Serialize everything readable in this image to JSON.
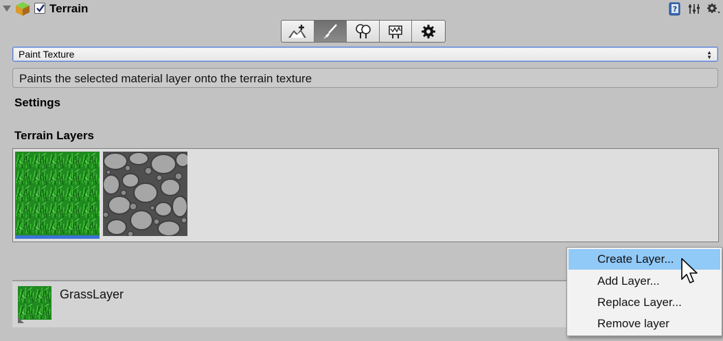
{
  "header": {
    "component_title": "Terrain",
    "enabled": true,
    "icons": [
      "foldout-arrow-icon",
      "terrain-cube-icon",
      "help-book-icon",
      "preset-sliders-icon",
      "settings-gear-icon"
    ]
  },
  "toolbar": {
    "tools": [
      {
        "icon": "raise-terrain-icon",
        "active": false
      },
      {
        "icon": "paint-brush-icon",
        "active": true
      },
      {
        "icon": "place-trees-icon",
        "active": false
      },
      {
        "icon": "paint-details-icon",
        "active": false
      },
      {
        "icon": "terrain-settings-gear-icon",
        "active": false
      }
    ]
  },
  "tool_mode": {
    "selected": "Paint Texture"
  },
  "description": "Paints the selected material layer onto the terrain texture",
  "sections": {
    "settings": "Settings",
    "terrain_layers": "Terrain Layers"
  },
  "terrain_layers": [
    {
      "texture": "grass",
      "selected": true
    },
    {
      "texture": "stone",
      "selected": false
    }
  ],
  "selected_layer": {
    "name": "GrassLayer"
  },
  "context_menu": {
    "items": [
      {
        "label": "Create Layer...",
        "highlighted": true
      },
      {
        "label": "Add Layer...",
        "highlighted": false
      },
      {
        "label": "Replace Layer...",
        "highlighted": false
      },
      {
        "label": "Remove layer",
        "highlighted": false
      }
    ]
  },
  "colors": {
    "background": "#c2c2c2",
    "selection_blue": "#3a73d4",
    "menu_highlight": "#91c9f7",
    "grass_green": "#1f8a1f"
  }
}
